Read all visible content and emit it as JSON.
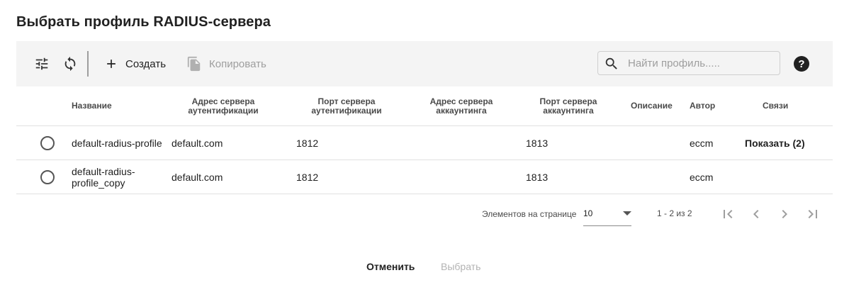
{
  "title": "Выбрать профиль RADIUS-сервера",
  "toolbar": {
    "filter_icon": "tune-icon",
    "refresh_icon": "sync-icon",
    "create_label": "Создать",
    "copy_label": "Копировать",
    "search_placeholder": "Найти профиль.....",
    "search_value": "",
    "help_label": "?"
  },
  "table": {
    "headers": {
      "name": "Название",
      "auth_addr_1": "Адрес сервера",
      "auth_addr_2": "аутентификации",
      "auth_port_1": "Порт сервера",
      "auth_port_2": "аутентификации",
      "acct_addr_1": "Адрес сервера",
      "acct_addr_2": "аккаунтинга",
      "acct_port_1": "Порт сервера",
      "acct_port_2": "аккаунтинга",
      "description": "Описание",
      "author": "Автор",
      "links": "Связи"
    },
    "rows": [
      {
        "name_1": "default-radius-profile",
        "name_2": "",
        "auth_addr": "default.com",
        "auth_port": "1812",
        "acct_addr": "",
        "acct_port": "1813",
        "description": "",
        "author": "eccm",
        "links": "Показать (2)"
      },
      {
        "name_1": "default-radius-",
        "name_2": "profile_copy",
        "auth_addr": "default.com",
        "auth_port": "1812",
        "acct_addr": "",
        "acct_port": "1813",
        "description": "",
        "author": "eccm",
        "links": ""
      }
    ]
  },
  "pagination": {
    "per_page_label": "Элементов на странице",
    "per_page_value": "10",
    "range": "1 - 2 из 2"
  },
  "footer": {
    "cancel": "Отменить",
    "select": "Выбрать"
  },
  "colors": {
    "toolbar_bg": "#f4f4f4",
    "text": "#212121",
    "disabled": "#9e9e9e"
  }
}
